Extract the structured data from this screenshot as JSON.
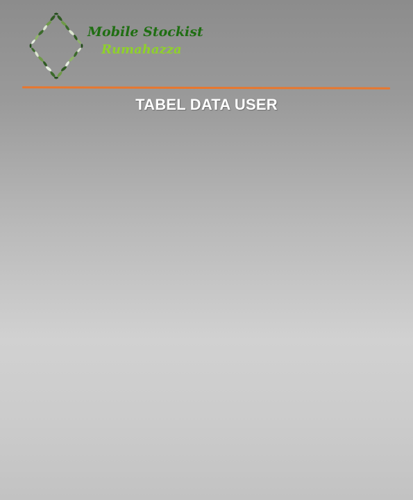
{
  "brand": {
    "name_line1": "Mobile Stockist",
    "name_line2": "Rumahazza",
    "logo_icon": "leaf-wreath-logo-icon"
  },
  "page": {
    "title": "TABEL DATA USER"
  },
  "colors": {
    "brand_dark_green": "#1f6e12",
    "brand_light_green": "#8fd12a",
    "divider_orange": "#e8772e",
    "title_text": "#ffffff"
  }
}
